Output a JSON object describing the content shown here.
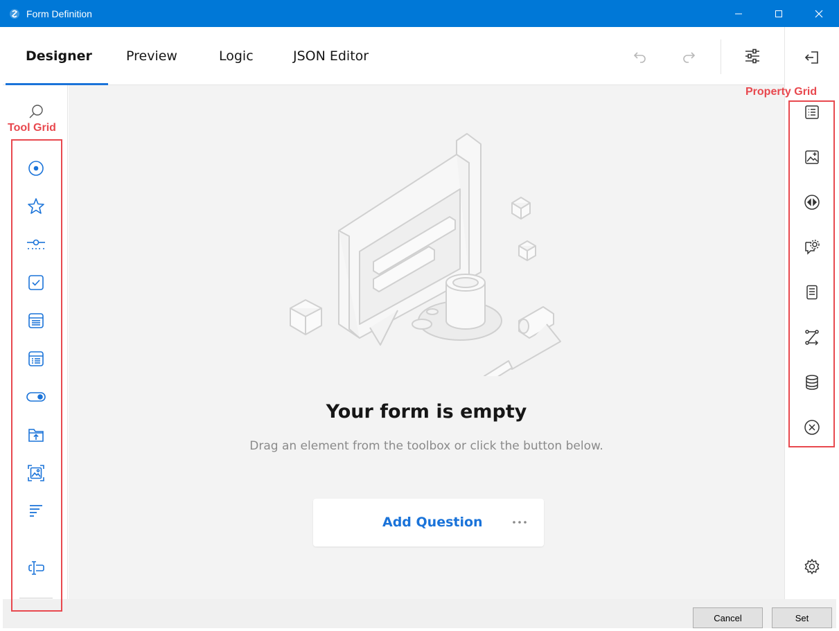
{
  "window": {
    "title": "Form Definition",
    "controls": [
      "minimize-icon",
      "maximize-icon",
      "close-icon"
    ]
  },
  "tabs": [
    {
      "label": "Designer",
      "active": true
    },
    {
      "label": "Preview",
      "active": false
    },
    {
      "label": "Logic",
      "active": false
    },
    {
      "label": "JSON Editor",
      "active": false
    }
  ],
  "toolbar": {
    "icons": [
      "undo-icon",
      "redo-icon",
      "settings-sliders-icon",
      "collapse-panel-icon"
    ]
  },
  "annotations": {
    "tool_grid": "Tool Grid",
    "property_grid": "Property Grid",
    "color": "#e8484e"
  },
  "toolbox": {
    "search_icon": "search-icon",
    "items": [
      "radio-group-icon",
      "rating-icon",
      "slider-icon",
      "checkbox-icon",
      "dropdown-icon",
      "tagbox-icon",
      "boolean-toggle-icon",
      "file-upload-icon",
      "image-picker-icon",
      "ranking-icon",
      "text-input-icon"
    ]
  },
  "property_grid": {
    "items": [
      "general-list-icon",
      "logo-image-icon",
      "navigation-icon",
      "question-settings-icon",
      "pages-icon",
      "logic-icon",
      "data-icon",
      "validation-icon"
    ],
    "bottom": "gear-icon"
  },
  "empty_state": {
    "title": "Your form is empty",
    "subtitle": "Drag an element from the toolbox or click the button below.",
    "button": "Add Question",
    "more": "more-options-icon"
  },
  "footer": {
    "cancel": "Cancel",
    "set": "Set"
  },
  "colors": {
    "titlebar": "#0078d7",
    "accent": "#1a73d9",
    "canvas": "#f3f3f3"
  }
}
